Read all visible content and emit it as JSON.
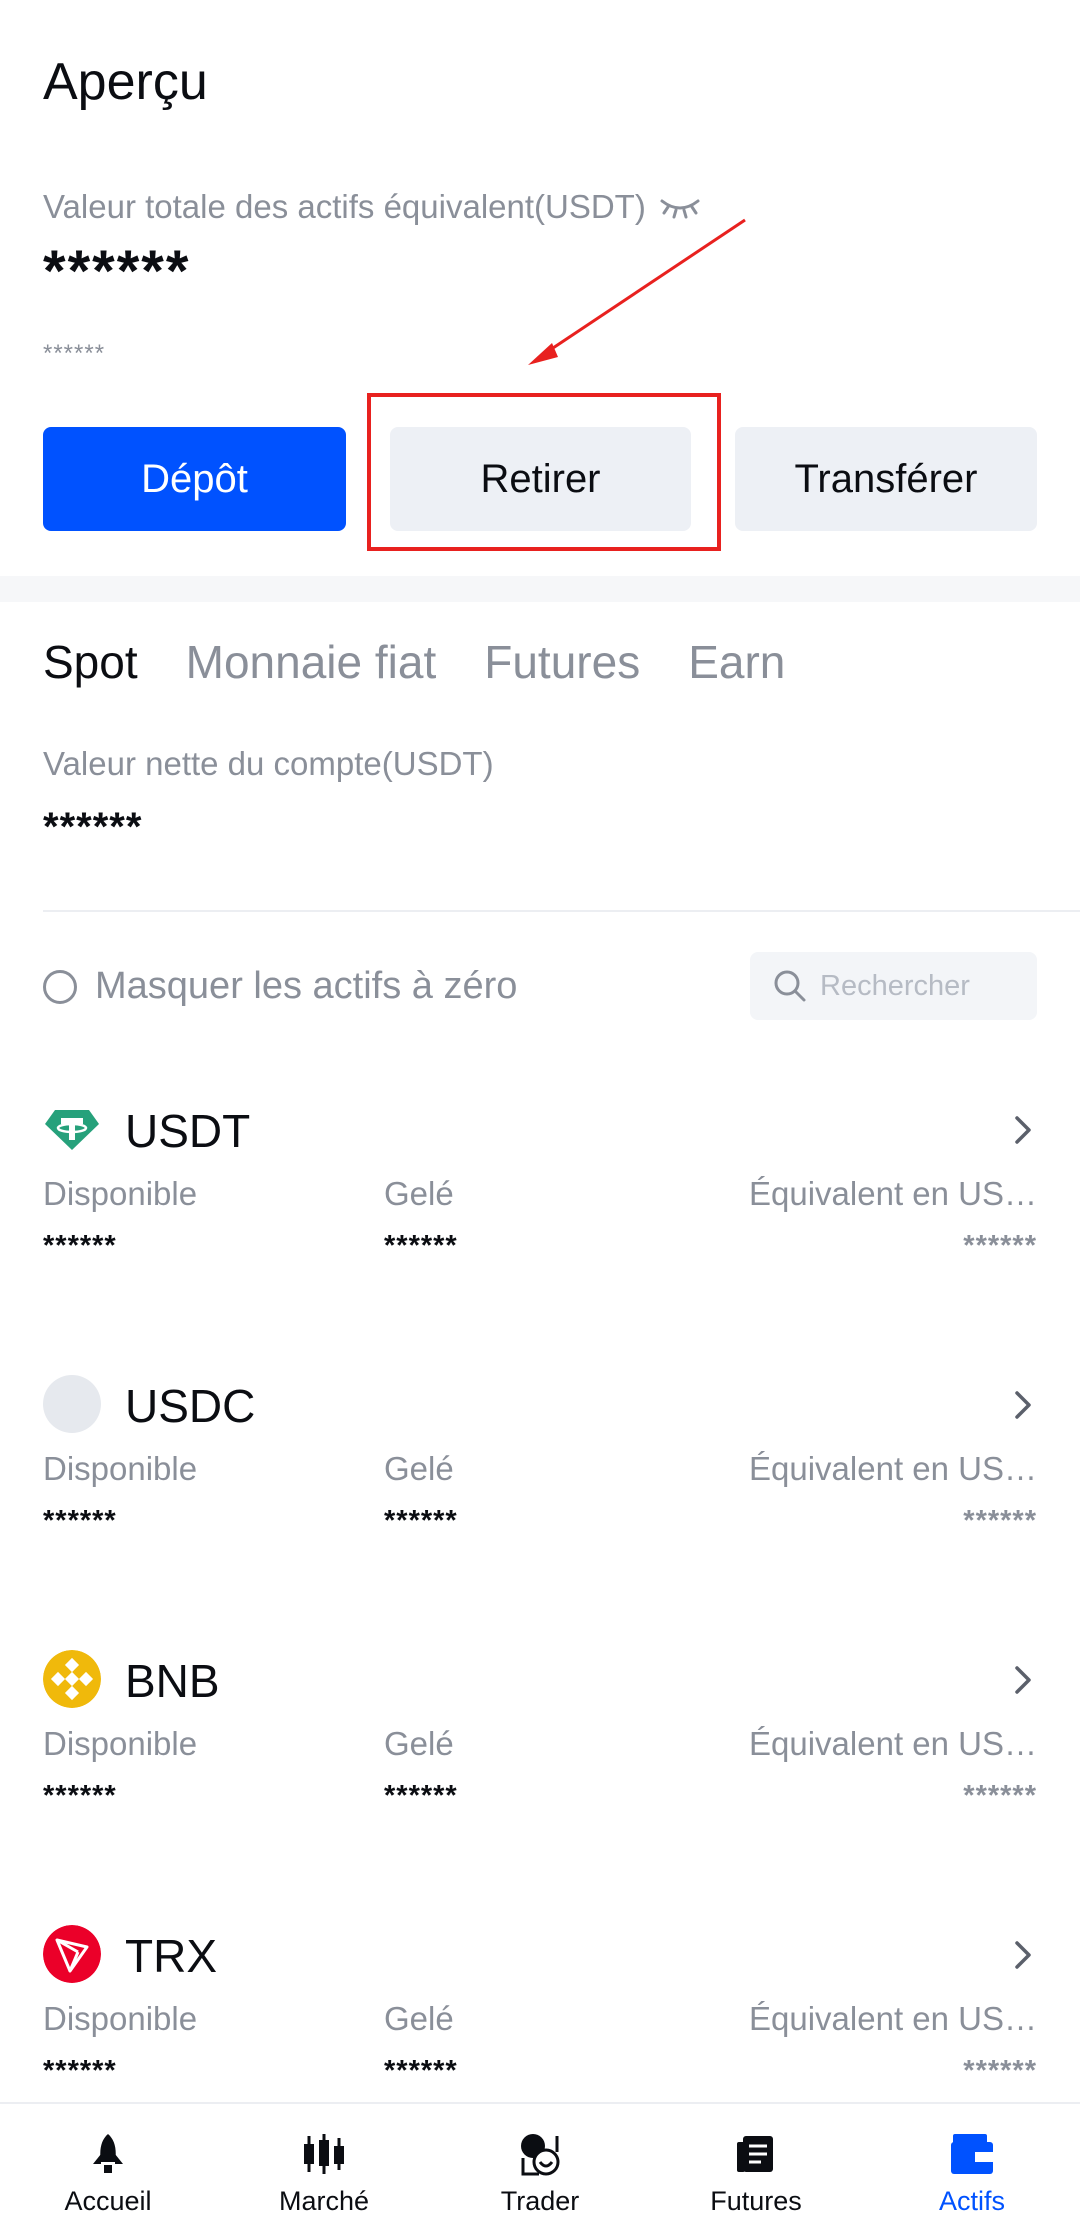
{
  "header": {
    "title": "Aperçu",
    "total_label": "Valeur totale des actifs équivalent(USDT)",
    "total_value": "******",
    "total_sub": "******"
  },
  "actions": {
    "deposit": "Dépôt",
    "withdraw": "Retirer",
    "transfer": "Transférer"
  },
  "tabs": [
    {
      "label": "Spot",
      "active": true
    },
    {
      "label": "Monnaie fiat",
      "active": false
    },
    {
      "label": "Futures",
      "active": false
    },
    {
      "label": "Earn",
      "active": false
    }
  ],
  "account": {
    "net_label": "Valeur nette du compte(USDT)",
    "net_value": "******"
  },
  "filter": {
    "hide_zero_label": "Masquer les actifs à zéro",
    "search_placeholder": "Rechercher"
  },
  "assets": [
    {
      "name": "USDT",
      "icon": "tether-icon",
      "available_label": "Disponible",
      "available": "******",
      "frozen_label": "Gelé",
      "frozen": "******",
      "equiv_label": "Équivalent en US…",
      "equiv": "******"
    },
    {
      "name": "USDC",
      "icon": "usdc-icon",
      "available_label": "Disponible",
      "available": "******",
      "frozen_label": "Gelé",
      "frozen": "******",
      "equiv_label": "Équivalent en US…",
      "equiv": "******"
    },
    {
      "name": "BNB",
      "icon": "bnb-icon",
      "available_label": "Disponible",
      "available": "******",
      "frozen_label": "Gelé",
      "frozen": "******",
      "equiv_label": "Équivalent en US…",
      "equiv": "******"
    },
    {
      "name": "TRX",
      "icon": "tron-icon",
      "available_label": "Disponible",
      "available": "******",
      "frozen_label": "Gelé",
      "frozen": "******",
      "equiv_label": "Équivalent en US…",
      "equiv": "******"
    }
  ],
  "nav": [
    {
      "label": "Accueil",
      "icon": "home-rocket-icon",
      "active": false
    },
    {
      "label": "Marché",
      "icon": "candlestick-icon",
      "active": false
    },
    {
      "label": "Trader",
      "icon": "trade-icon",
      "active": false
    },
    {
      "label": "Futures",
      "icon": "futures-icon",
      "active": false
    },
    {
      "label": "Actifs",
      "icon": "wallet-icon",
      "active": true
    }
  ],
  "colors": {
    "accent": "#0052ff",
    "highlight": "#e8211f",
    "muted": "#8a8f99",
    "usdt": "#26a17b",
    "bnb": "#f0b90b",
    "trx": "#eb0029",
    "usdc_placeholder": "#e6e9ee"
  }
}
